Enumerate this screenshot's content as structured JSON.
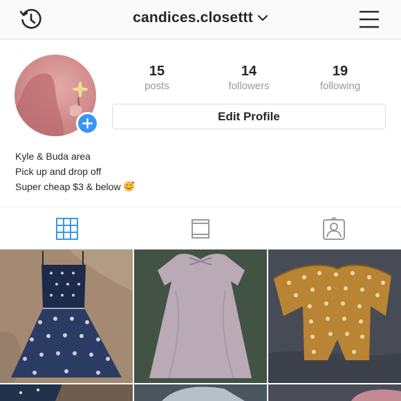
{
  "header": {
    "username": "candices.closettt",
    "icons": [
      "history-icon",
      "chevron-down-icon",
      "menu-icon"
    ]
  },
  "profile": {
    "stats": [
      {
        "value": "15",
        "label": "posts"
      },
      {
        "value": "14",
        "label": "followers"
      },
      {
        "value": "19",
        "label": "following"
      }
    ],
    "edit_button": "Edit Profile",
    "bio": [
      "Kyle & Buda area",
      "Pick up and drop off",
      "Super cheap $3 & below"
    ],
    "bio_emoji": "smiling-face-with-hearts",
    "add_badge_icon": "plus-icon"
  },
  "tabs": [
    {
      "name": "grid",
      "icon": "grid-icon",
      "active": true
    },
    {
      "name": "list",
      "icon": "list-icon",
      "active": false
    },
    {
      "name": "tagged",
      "icon": "tagged-icon",
      "active": false
    }
  ],
  "posts": [
    {
      "item": "navy patterned sundress"
    },
    {
      "item": "lavender t-shirt dress"
    },
    {
      "item": "mustard floral off-shoulder top"
    }
  ],
  "colors": {
    "accent": "#3897f0",
    "muted": "#999999",
    "border": "#dbdbdb"
  }
}
